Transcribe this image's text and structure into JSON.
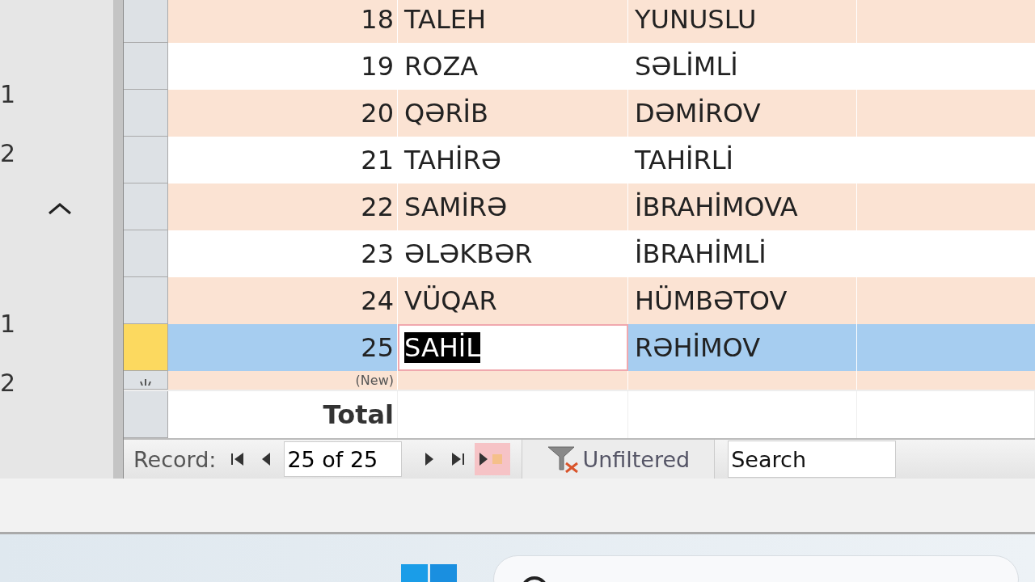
{
  "nav_pane": {
    "items": [
      {
        "kind": "text",
        "text": "1"
      },
      {
        "kind": "text",
        "text": "2"
      },
      {
        "kind": "chevron"
      },
      {
        "kind": "text",
        "text": "1"
      },
      {
        "kind": "text",
        "text": "2"
      }
    ]
  },
  "table": {
    "rows": [
      {
        "column_1": "18",
        "column_2": "TALEH",
        "column_3": "YUNUSLU",
        "selected": false,
        "editing": false
      },
      {
        "column_1": "19",
        "column_2": "ROZA",
        "column_3": "SƏLİMLİ",
        "selected": false,
        "editing": false
      },
      {
        "column_1": "20",
        "column_2": "QƏRİB",
        "column_3": "DƏMİROV",
        "selected": false,
        "editing": false
      },
      {
        "column_1": "21",
        "column_2": "TAHİRƏ",
        "column_3": "TAHİRLİ",
        "selected": false,
        "editing": false
      },
      {
        "column_1": "22",
        "column_2": "SAMİRƏ",
        "column_3": "İBRAHİMOVA",
        "selected": false,
        "editing": false
      },
      {
        "column_1": "23",
        "column_2": "ƏLƏKBƏR",
        "column_3": "İBRAHİMLİ",
        "selected": false,
        "editing": false
      },
      {
        "column_1": "24",
        "column_2": "VÜQAR",
        "column_3": "HÜMBƏTOV",
        "selected": false,
        "editing": false
      },
      {
        "column_1": "25",
        "column_2": "SAHİL",
        "column_3": "RƏHİMOV",
        "selected": true,
        "editing": true
      }
    ],
    "new_row": {
      "column_1": "(New)"
    },
    "total_row": {
      "label": "Total"
    }
  },
  "record_nav": {
    "label": "Record:",
    "position": "25 of 25",
    "new_record_disabled": true,
    "filter": "Unfiltered",
    "search": {
      "placeholder": "Search"
    }
  }
}
